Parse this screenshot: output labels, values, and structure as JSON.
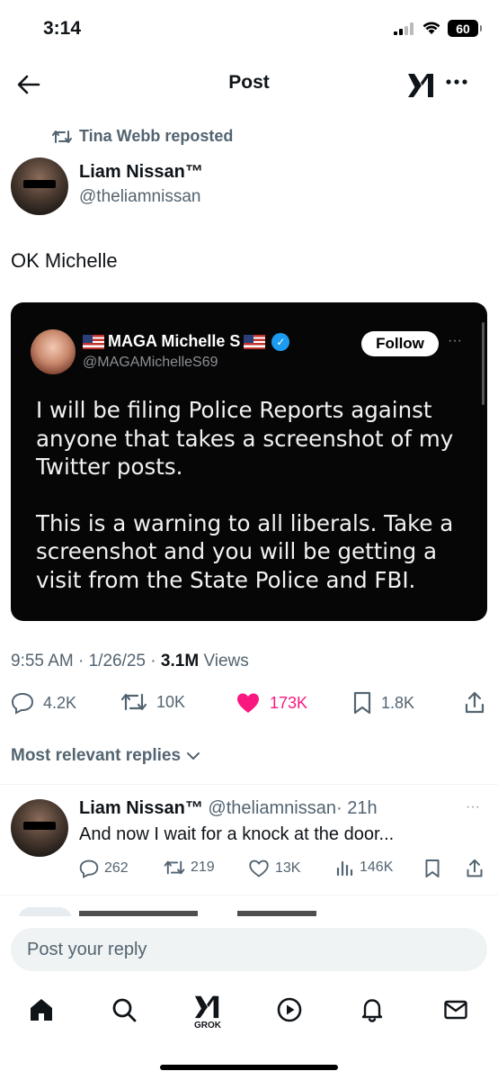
{
  "status_bar": {
    "time": "3:14",
    "battery": "60"
  },
  "header": {
    "title": "Post",
    "logo_text": "X"
  },
  "repost": {
    "text": "Tina Webb reposted"
  },
  "author": {
    "name": "Liam Nissan™",
    "handle": "@theliamnissan"
  },
  "post": {
    "text": "OK Michelle",
    "time": "9:55 AM",
    "date": "1/26/25",
    "views_count": "3.1M",
    "views_label": "Views"
  },
  "embed": {
    "name": "MAGA Michelle S",
    "handle": "@MAGAMichelleS69",
    "follow_label": "Follow",
    "more": "···",
    "paragraph_1": "I will be filing Police Reports against anyone that takes a screenshot of my Twitter posts.",
    "paragraph_2": "This is a warning to all liberals. Take a screenshot and you will be getting a visit from the State Police and FBI."
  },
  "actions": {
    "replies": "4.2K",
    "reposts": "10K",
    "likes": "173K",
    "bookmarks": "1.8K"
  },
  "replies_section": {
    "heading": "Most relevant replies"
  },
  "reply": {
    "name": "Liam Nissan™",
    "handle": "@theliamnissan",
    "time": "· 21h",
    "text": "And now I wait for a knock at the door...",
    "more": "···",
    "replies": "262",
    "reposts": "219",
    "likes": "13K",
    "views": "146K"
  },
  "composer": {
    "placeholder": "Post your reply"
  },
  "tabbar": {
    "grok_label": "GROK"
  },
  "colors": {
    "like": "#f91880",
    "secondary_text": "#536471",
    "verified": "#1d9bf0"
  }
}
